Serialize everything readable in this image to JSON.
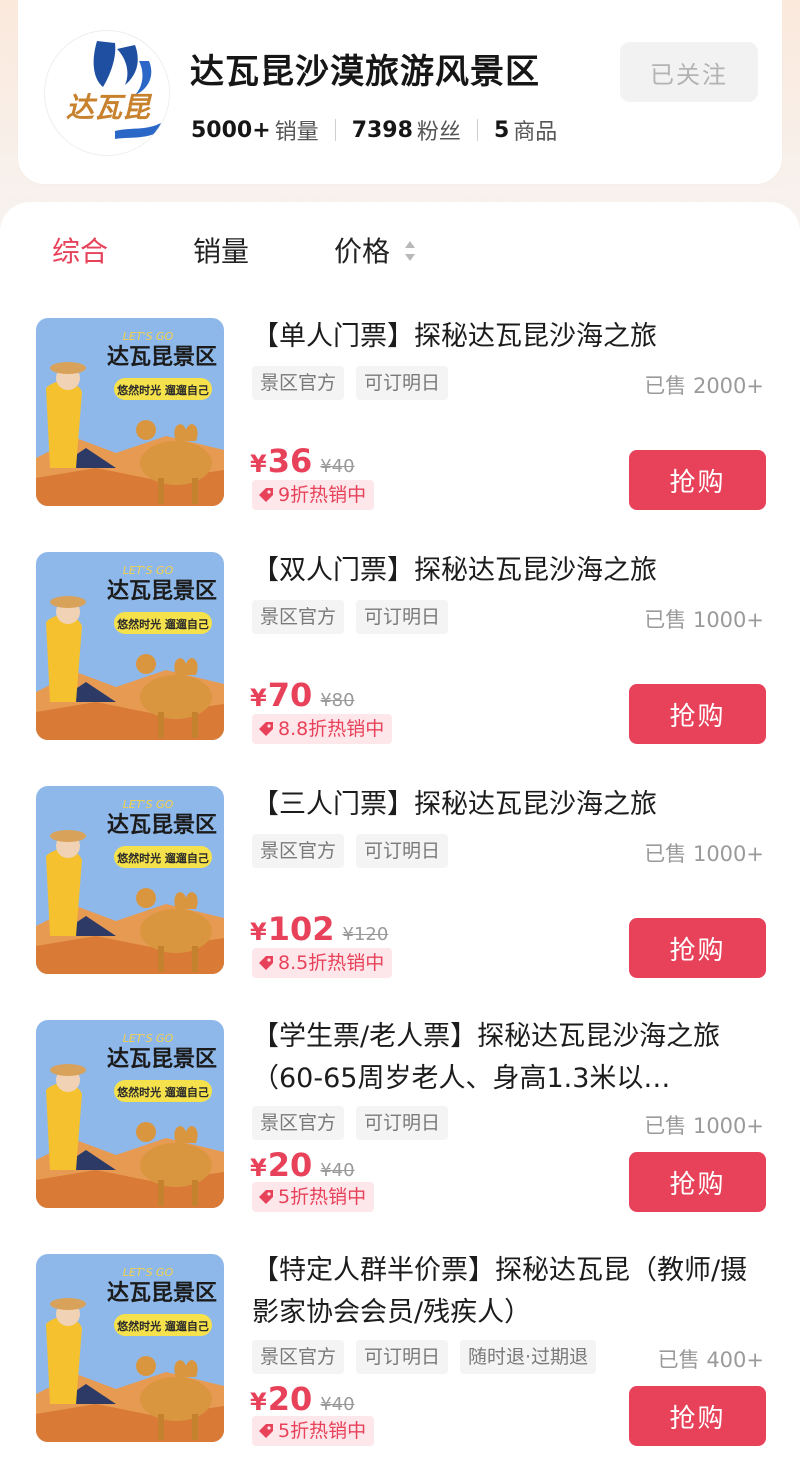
{
  "shop": {
    "name": "达瓦昆沙漠旅游风景区",
    "logo_text": "达瓦昆",
    "sales_num": "5000+",
    "sales_label": "销量",
    "fans_num": "7398",
    "fans_label": "粉丝",
    "goods_num": "5",
    "goods_label": "商品",
    "follow_label": "已关注"
  },
  "sort": {
    "comprehensive": "综合",
    "sales": "销量",
    "price": "价格"
  },
  "thumb": {
    "lets_go": "LET'S GO",
    "headline": "达瓦昆景区",
    "slogan": "悠然时光 遛遛自己"
  },
  "products": [
    {
      "title": "【单人门票】探秘达瓦昆沙海之旅",
      "tags": [
        "景区官方",
        "可订明日"
      ],
      "sold": "已售 2000+",
      "yen": "¥",
      "price": "36",
      "orig": "¥40",
      "promo": "9折热销中",
      "buy": "抢购"
    },
    {
      "title": "【双人门票】探秘达瓦昆沙海之旅",
      "tags": [
        "景区官方",
        "可订明日"
      ],
      "sold": "已售 1000+",
      "yen": "¥",
      "price": "70",
      "orig": "¥80",
      "promo": "8.8折热销中",
      "buy": "抢购"
    },
    {
      "title": "【三人门票】探秘达瓦昆沙海之旅",
      "tags": [
        "景区官方",
        "可订明日"
      ],
      "sold": "已售 1000+",
      "yen": "¥",
      "price": "102",
      "orig": "¥120",
      "promo": "8.5折热销中",
      "buy": "抢购"
    },
    {
      "title": "【学生票/老人票】探秘达瓦昆沙海之旅（60-65周岁老人、身高1.3米以…",
      "tags": [
        "景区官方",
        "可订明日"
      ],
      "sold": "已售 1000+",
      "yen": "¥",
      "price": "20",
      "orig": "¥40",
      "promo": "5折热销中",
      "buy": "抢购"
    },
    {
      "title": "【特定人群半价票】探秘达瓦昆（教师/摄影家协会会员/残疾人）",
      "tags": [
        "景区官方",
        "可订明日",
        "随时退·过期退"
      ],
      "sold": "已售 400+",
      "yen": "¥",
      "price": "20",
      "orig": "¥40",
      "promo": "5折热销中",
      "buy": "抢购"
    }
  ],
  "colors": {
    "accent": "#e8425a",
    "promo_bg": "#fde7ea",
    "tag_bg": "#f4f4f4"
  }
}
